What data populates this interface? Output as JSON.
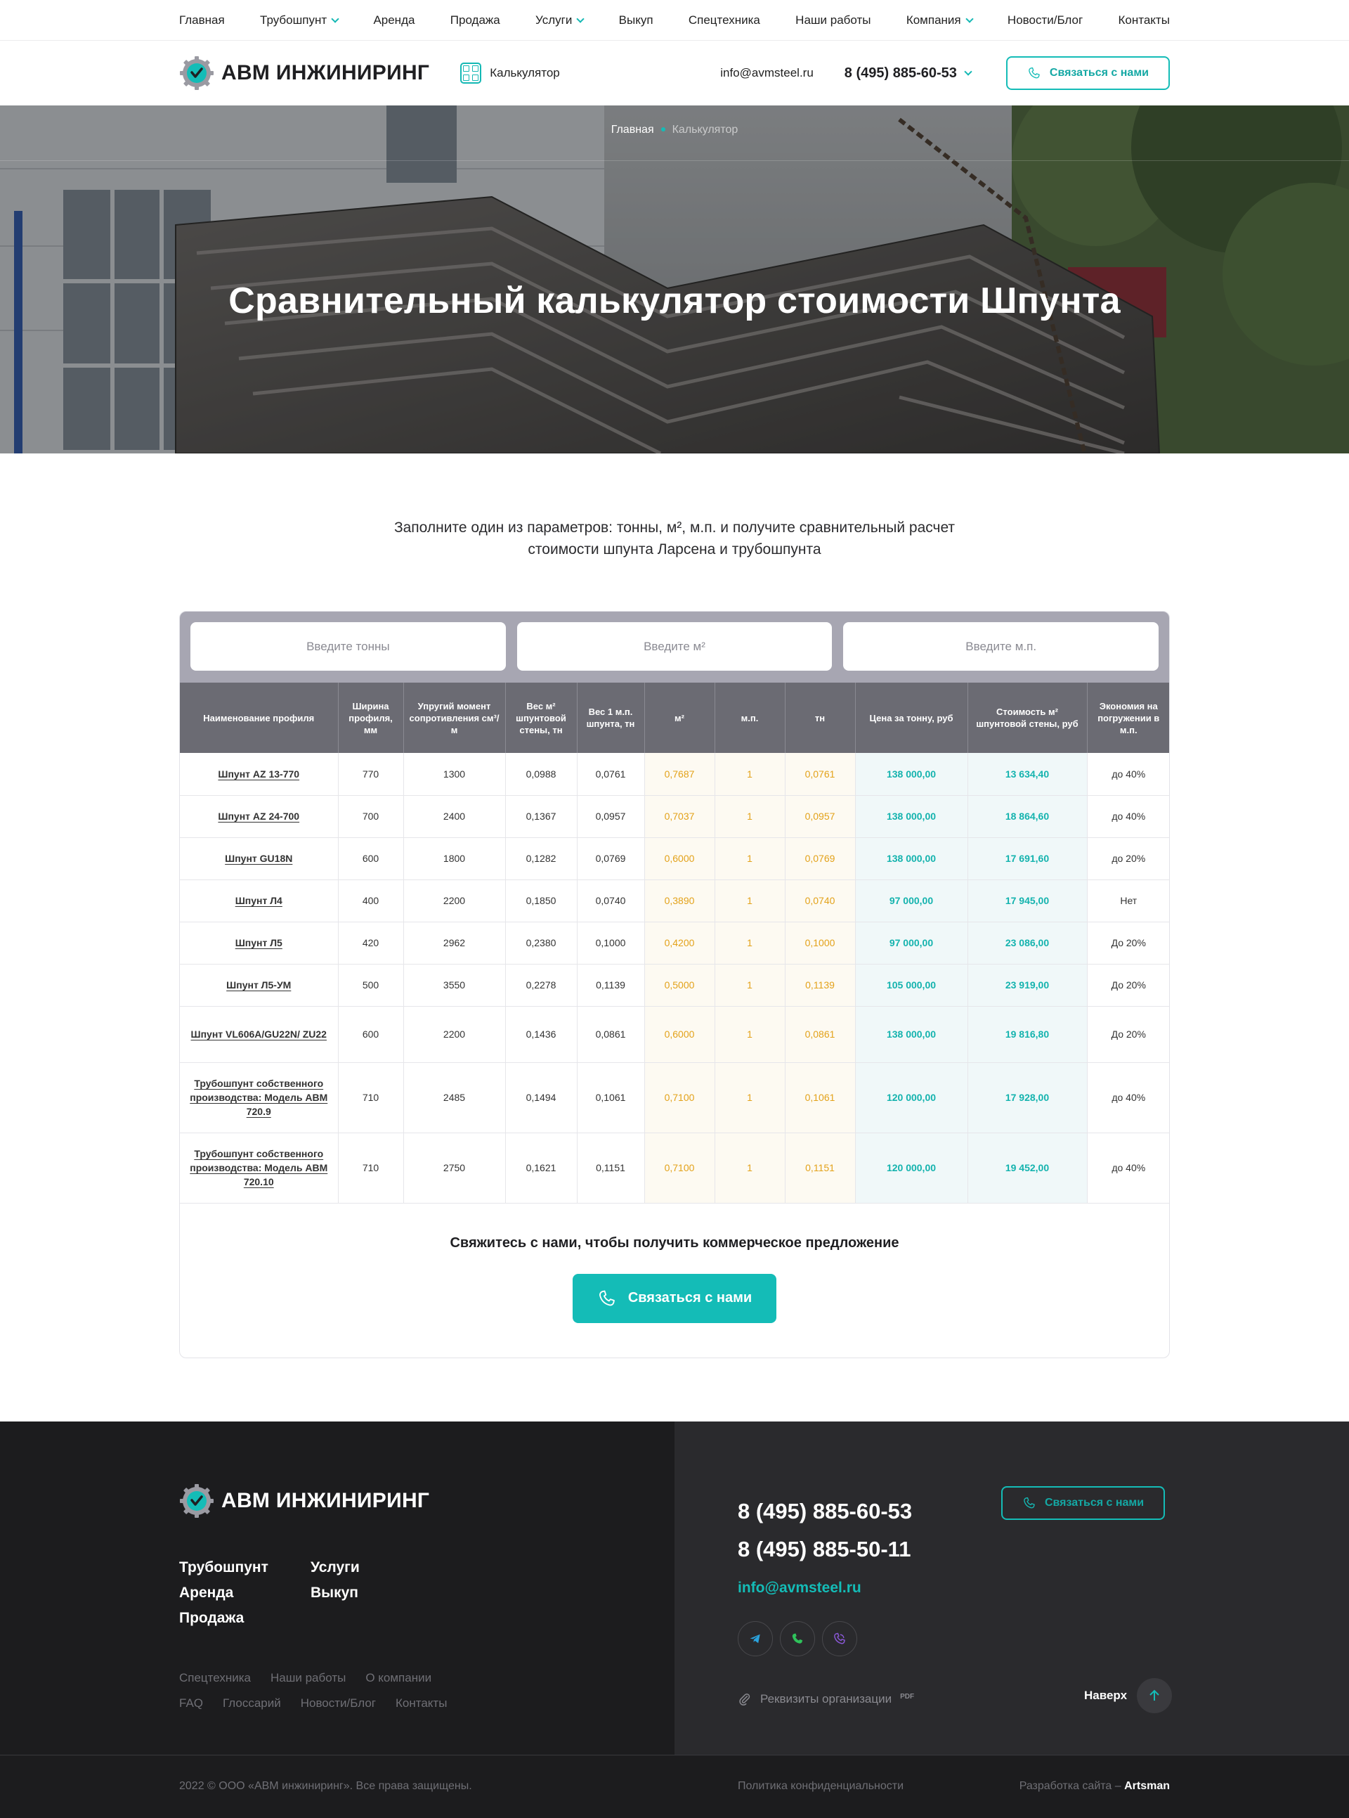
{
  "topnav": {
    "items": [
      {
        "label": "Главная",
        "dropdown": false
      },
      {
        "label": "Трубошпунт",
        "dropdown": true
      },
      {
        "label": "Аренда",
        "dropdown": false
      },
      {
        "label": "Продажа",
        "dropdown": false
      },
      {
        "label": "Услуги",
        "dropdown": true
      },
      {
        "label": "Выкуп",
        "dropdown": false
      },
      {
        "label": "Спецтехника",
        "dropdown": false
      },
      {
        "label": "Наши работы",
        "dropdown": false
      },
      {
        "label": "Компания",
        "dropdown": true
      },
      {
        "label": "Новости/Блог",
        "dropdown": false
      },
      {
        "label": "Контакты",
        "dropdown": false
      }
    ]
  },
  "header": {
    "logo_text": "АВМ ИНЖИНИРИНГ",
    "calculator_label": "Калькулятор",
    "email": "info@avmsteel.ru",
    "phone": "8 (495) 885-60-53",
    "contact_button": "Связаться с нами"
  },
  "hero": {
    "breadcrumb_home": "Главная",
    "breadcrumb_current": "Калькулятор",
    "title": "Сравнительный калькулятор стоимости Шпунта"
  },
  "intro": {
    "line1": "Заполните один из параметров: тонны, м², м.п. и получите сравнительный расчет",
    "line2": "стоимости шпунта Ларсена и трубошпунта"
  },
  "calculator": {
    "inputs": {
      "tons_placeholder": "Введите тонны",
      "m2_placeholder": "Введите м²",
      "mp_placeholder": "Введите м.п."
    },
    "headers": [
      "Наименование профиля",
      "Ширина профиля, мм",
      "Упругий момент сопротивления см³/м",
      "Вес м² шпунтовой стены, тн",
      "Вес 1 м.п. шпунта, тн",
      "м²",
      "м.п.",
      "тн",
      "Цена за тонну, руб",
      "Стоимость  м² шпунтовой стены, руб",
      "Экономия на погружении в м.п."
    ],
    "rows": [
      {
        "name": "Шпунт AZ 13-770",
        "width": "770",
        "moment": "1300",
        "w_m2": "0,0988",
        "w_mp": "0,0761",
        "m2": "0,7687",
        "mp": "1",
        "tn": "0,0761",
        "price": "138 000,00",
        "cost": "13 634,40",
        "econ": "до 40%"
      },
      {
        "name": "Шпунт AZ 24-700",
        "width": "700",
        "moment": "2400",
        "w_m2": "0,1367",
        "w_mp": "0,0957",
        "m2": "0,7037",
        "mp": "1",
        "tn": "0,0957",
        "price": "138 000,00",
        "cost": "18 864,60",
        "econ": "до 40%"
      },
      {
        "name": "Шпунт GU18N",
        "width": "600",
        "moment": "1800",
        "w_m2": "0,1282",
        "w_mp": "0,0769",
        "m2": "0,6000",
        "mp": "1",
        "tn": "0,0769",
        "price": "138 000,00",
        "cost": "17 691,60",
        "econ": "до 20%"
      },
      {
        "name": "Шпунт Л4",
        "width": "400",
        "moment": "2200",
        "w_m2": "0,1850",
        "w_mp": "0,0740",
        "m2": "0,3890",
        "mp": "1",
        "tn": "0,0740",
        "price": "97 000,00",
        "cost": "17 945,00",
        "econ": "Нет"
      },
      {
        "name": "Шпунт Л5",
        "width": "420",
        "moment": "2962",
        "w_m2": "0,2380",
        "w_mp": "0,1000",
        "m2": "0,4200",
        "mp": "1",
        "tn": "0,1000",
        "price": "97 000,00",
        "cost": "23 086,00",
        "econ": "До 20%"
      },
      {
        "name": "Шпунт Л5-УМ",
        "width": "500",
        "moment": "3550",
        "w_m2": "0,2278",
        "w_mp": "0,1139",
        "m2": "0,5000",
        "mp": "1",
        "tn": "0,1139",
        "price": "105 000,00",
        "cost": "23 919,00",
        "econ": "До 20%"
      },
      {
        "name": "Шпунт VL606A/GU22N/ ZU22",
        "width": "600",
        "moment": "2200",
        "w_m2": "0,1436",
        "w_mp": "0,0861",
        "m2": "0,6000",
        "mp": "1",
        "tn": "0,0861",
        "price": "138 000,00",
        "cost": "19 816,80",
        "econ": "До 20%"
      },
      {
        "name": "Трубошпунт собственного производства: Модель АВМ 720.9",
        "width": "710",
        "moment": "2485",
        "w_m2": "0,1494",
        "w_mp": "0,1061",
        "m2": "0,7100",
        "mp": "1",
        "tn": "0,1061",
        "price": "120 000,00",
        "cost": "17 928,00",
        "econ": "до 40%"
      },
      {
        "name": "Трубошпунт собственного производства: Модель АВМ 720.10",
        "width": "710",
        "moment": "2750",
        "w_m2": "0,1621",
        "w_mp": "0,1151",
        "m2": "0,7100",
        "mp": "1",
        "tn": "0,1151",
        "price": "120 000,00",
        "cost": "19 452,00",
        "econ": "до 40%"
      }
    ],
    "cta_text": "Свяжитесь с нами, чтобы получить коммерческое предложение",
    "cta_button": "Связаться с нами"
  },
  "footer": {
    "logo_text": "АВМ ИНЖИНИРИНГ",
    "menu": [
      "Трубошпунт",
      "Услуги",
      "Аренда",
      "Выкуп",
      "Продажа"
    ],
    "sub_row1": [
      "Спецтехника",
      "Наши работы",
      "О компании"
    ],
    "sub_row2": [
      "FAQ",
      "Глоссарий",
      "Новости/Блог",
      "Контакты"
    ],
    "phone1": "8 (495) 885-60-53",
    "phone2": "8 (495) 885-50-11",
    "email": "info@avmsteel.ru",
    "contact_button": "Связаться с нами",
    "requisites": "Реквизиты организации",
    "requisites_badge": "PDF",
    "up_label": "Наверх",
    "copyright": "2022 © ООО «АВМ инжиниринг». Все права защищены.",
    "policy": "Политика конфиденциальности",
    "dev_prefix": "Разработка сайта – ",
    "dev_name": "Artsman"
  },
  "colors": {
    "accent": "#14bcb7",
    "yellow_value": "#e3a21a",
    "table_header": "#6b6b73",
    "inputs_bar": "#a7a6b2",
    "footer_bg": "#1c1c1e"
  }
}
